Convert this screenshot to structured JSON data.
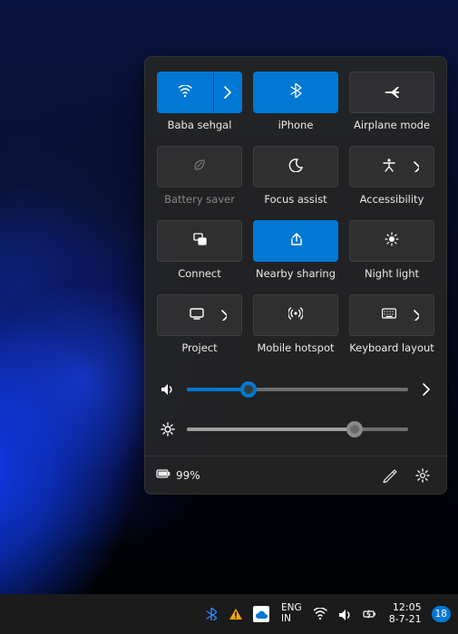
{
  "accent": "#0078d4",
  "panel": {
    "tiles": [
      {
        "id": "wifi",
        "label": "Baba sehgal",
        "state": "active",
        "split": true
      },
      {
        "id": "bluetooth",
        "label": "iPhone",
        "state": "active",
        "split": false
      },
      {
        "id": "airplane",
        "label": "Airplane mode",
        "state": "off",
        "split": false
      },
      {
        "id": "batterysaver",
        "label": "Battery saver",
        "state": "disabled",
        "split": false
      },
      {
        "id": "focusassist",
        "label": "Focus assist",
        "state": "off",
        "split": false
      },
      {
        "id": "accessibility",
        "label": "Accessibility",
        "state": "off",
        "split": false,
        "chevron": true
      },
      {
        "id": "connect",
        "label": "Connect",
        "state": "off",
        "split": false
      },
      {
        "id": "nearbysharing",
        "label": "Nearby sharing",
        "state": "active",
        "split": false
      },
      {
        "id": "nightlight",
        "label": "Night light",
        "state": "off",
        "split": false
      },
      {
        "id": "project",
        "label": "Project",
        "state": "off",
        "split": false,
        "chevron": true
      },
      {
        "id": "mobilehotspot",
        "label": "Mobile hotspot",
        "state": "off",
        "split": false
      },
      {
        "id": "keyboardlayout",
        "label": "Keyboard layout",
        "state": "off",
        "split": false,
        "chevron": true
      }
    ],
    "volume_pct": 28,
    "brightness_pct": 76,
    "battery_text": "99%"
  },
  "taskbar": {
    "lang_top": "ENG",
    "lang_bottom": "IN",
    "time": "12:05",
    "date": "8-7-21",
    "notifications": "18"
  }
}
